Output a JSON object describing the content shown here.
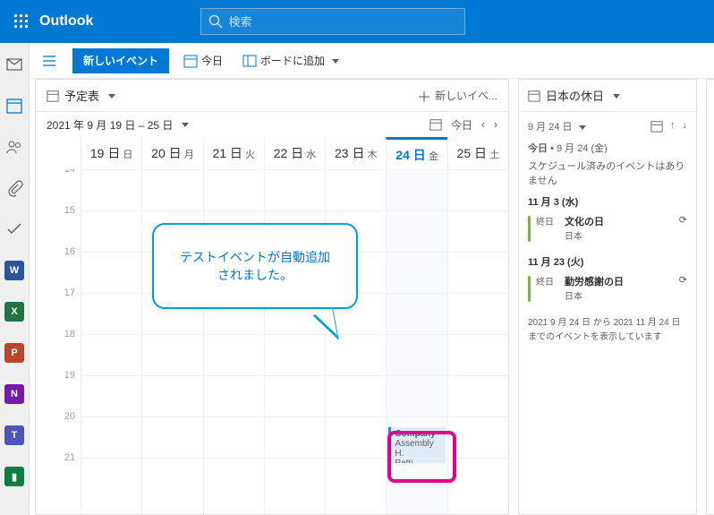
{
  "header": {
    "appName": "Outlook",
    "searchPlaceholder": "検索"
  },
  "cmdbar": {
    "newEvent": "新しいイベント",
    "today": "今日",
    "addToBoard": "ボードに追加"
  },
  "calendar": {
    "title": "予定表",
    "newLabel": "新しいイベ...",
    "rangeLabel": "2021 年 9 月 19 日 – 25 日",
    "todayLabel": "今日",
    "days": [
      {
        "num": "19 日",
        "dow": "日"
      },
      {
        "num": "20 日",
        "dow": "月"
      },
      {
        "num": "21 日",
        "dow": "火"
      },
      {
        "num": "22 日",
        "dow": "水"
      },
      {
        "num": "23 日",
        "dow": "木"
      },
      {
        "num": "24 日",
        "dow": "金",
        "today": true
      },
      {
        "num": "25 日",
        "dow": "土"
      }
    ],
    "hours": [
      "14",
      "15",
      "16",
      "17",
      "18",
      "19",
      "20",
      "21"
    ],
    "event": {
      "title": "Company",
      "line2": "Assembly H.",
      "line3": "Patti Fernan"
    }
  },
  "callout": {
    "line1": "テストイベントが自動追加",
    "line2": "されました。"
  },
  "sidebar": {
    "title": "日本の休日",
    "dateLabel": "9 月 24 日",
    "todayLine": {
      "prefix": "今日",
      "bullet": "•",
      "date": "9 月 24 (金)"
    },
    "noEvents": "スケジュール済みのイベントはありません",
    "h1": {
      "date": "11 月 3 (水)",
      "allday": "終日",
      "title": "文化の日",
      "region": "日本"
    },
    "h2": {
      "date": "11 月 23 (火)",
      "allday": "終日",
      "title": "勤労感謝の日",
      "region": "日本"
    },
    "rangeNote": "2021 9 月 24 日 から 2021 11 月 24 日 までのイベントを表示しています"
  }
}
